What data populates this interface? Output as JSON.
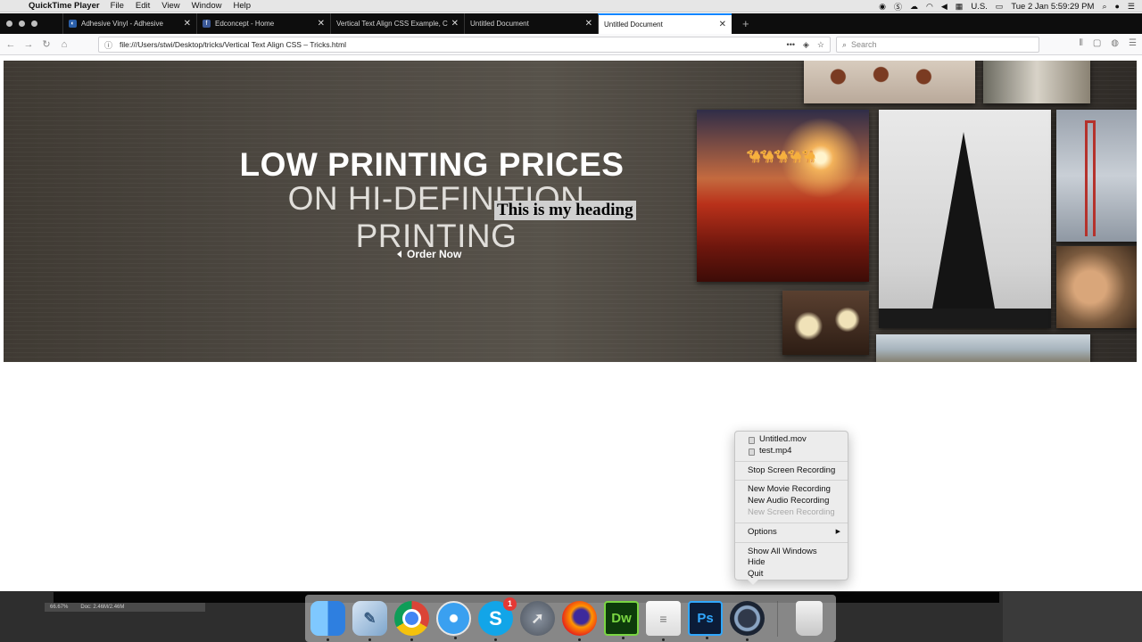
{
  "menubar": {
    "app_name": "QuickTime Player",
    "menus": [
      "File",
      "Edit",
      "View",
      "Window",
      "Help"
    ],
    "input_source": "U.S.",
    "clock": "Tue 2 Jan  5:59:29 PM"
  },
  "browser": {
    "tabs": [
      {
        "label": "Adhesive Vinyl - Adhesive",
        "icon": "vinyl-favicon",
        "active": false
      },
      {
        "label": "Edconcept - Home",
        "icon": "facebook-favicon",
        "active": false
      },
      {
        "label": "Vertical Text Align CSS Example, Cr",
        "icon": "",
        "active": false
      },
      {
        "label": "Untitled Document",
        "icon": "",
        "active": false
      },
      {
        "label": "Untitled Document",
        "icon": "",
        "active": true
      }
    ],
    "url": "file:///Users/stwi/Desktop/tricks/Vertical Text Align CSS – Tricks.html",
    "search_placeholder": "Search"
  },
  "hero": {
    "title": "LOW PRINTING PRICES",
    "subtitle": "ON HI-DEFINITION PRINTING",
    "heading_overlay": "This is my heading",
    "cta": "Order Now"
  },
  "photoshop_status": {
    "zoom": "66.67%",
    "doc": "Doc: 2.46M/2.46M"
  },
  "dock": {
    "items": [
      "Finder",
      "Preview",
      "Google Chrome",
      "Safari",
      "Skype",
      "Launchpad",
      "Firefox",
      "Dreamweaver",
      "TextEdit",
      "Photoshop",
      "QuickTime Player",
      "Trash"
    ],
    "skype_badge": "1",
    "dw_label": "Dw",
    "ps_label": "Ps"
  },
  "context_menu": {
    "recent_files": [
      "Untitled.mov",
      "test.mp4"
    ],
    "stop": "Stop Screen Recording",
    "new_movie": "New Movie Recording",
    "new_audio": "New Audio Recording",
    "new_screen": "New Screen Recording",
    "options": "Options",
    "show_all": "Show All Windows",
    "hide": "Hide",
    "quit": "Quit"
  },
  "colors": {
    "tab_accent": "#0a84ff",
    "menu_bg": "#ececec",
    "heading_bg": "#cfcfcf"
  }
}
